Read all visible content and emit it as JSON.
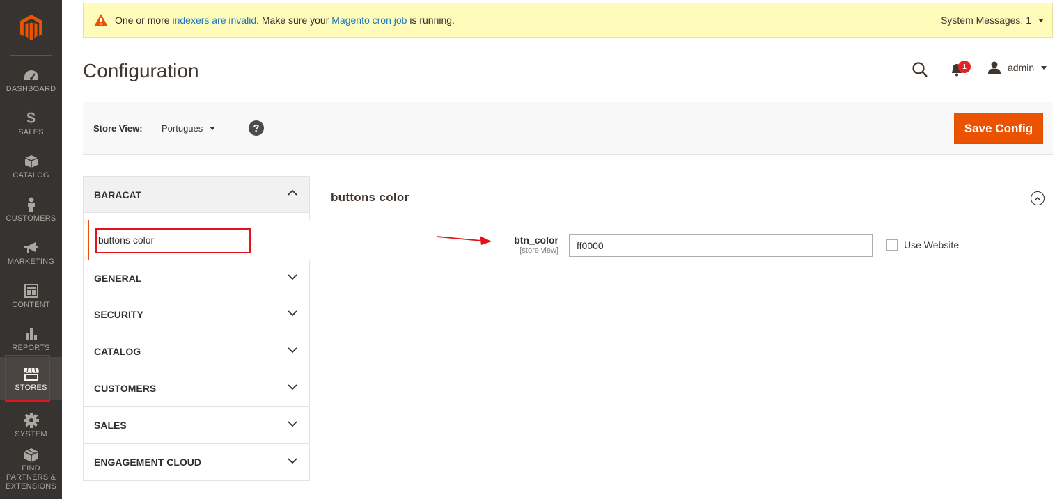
{
  "sidebar": {
    "items": [
      {
        "label": "DASHBOARD",
        "icon": "dashboard-icon"
      },
      {
        "label": "SALES",
        "icon": "dollar-icon"
      },
      {
        "label": "CATALOG",
        "icon": "box-icon"
      },
      {
        "label": "CUSTOMERS",
        "icon": "person-icon"
      },
      {
        "label": "MARKETING",
        "icon": "megaphone-icon"
      },
      {
        "label": "CONTENT",
        "icon": "layout-icon"
      },
      {
        "label": "REPORTS",
        "icon": "bar-chart-icon"
      },
      {
        "label": "STORES",
        "icon": "storefront-icon"
      },
      {
        "label": "SYSTEM",
        "icon": "gear-icon"
      },
      {
        "label": "FIND PARTNERS & EXTENSIONS",
        "icon": "extensions-icon"
      }
    ]
  },
  "message": {
    "pre": "One or more ",
    "link1": "indexers are invalid",
    "mid": ". Make sure your ",
    "link2": "Magento cron job",
    "post": " is running.",
    "system_messages": "System Messages: 1"
  },
  "header": {
    "title": "Configuration",
    "notification_count": "1",
    "user": "admin"
  },
  "toolbar": {
    "store_view_label": "Store View:",
    "store_view_value": "Portugues",
    "help": "?",
    "save_label": "Save Config"
  },
  "config_nav": {
    "active_tab": "BARACAT",
    "active_item": "buttons color",
    "tabs": [
      "GENERAL",
      "SECURITY",
      "CATALOG",
      "CUSTOMERS",
      "SALES",
      "ENGAGEMENT CLOUD"
    ]
  },
  "section": {
    "title": "buttons color",
    "field_label": "btn_color",
    "field_scope": "[store view]",
    "field_value": "ff0000",
    "use_website_label": "Use Website"
  },
  "colors": {
    "accent": "#eb5202",
    "sidebar_bg": "#373330",
    "link": "#1979c3",
    "highlight_box": "#e0141a"
  }
}
